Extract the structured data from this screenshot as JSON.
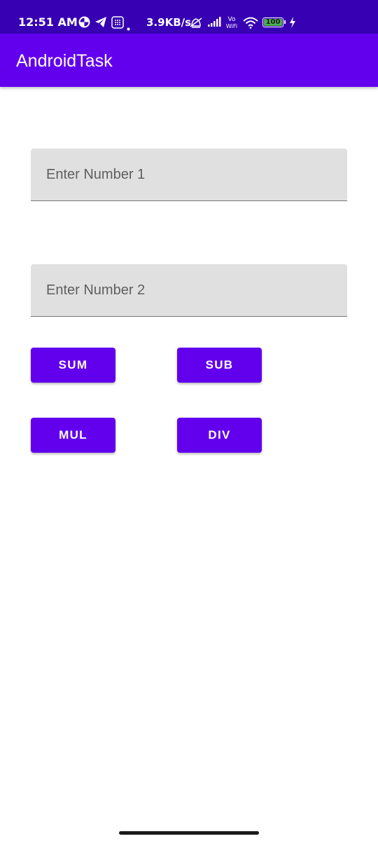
{
  "status_bar": {
    "time": "12:51 AM",
    "network_speed": "3.9KB/s",
    "battery": "100",
    "icons": [
      "data-saver-icon",
      "telegram-icon",
      "notification-icon",
      "dot-icon",
      "alarm-off-icon",
      "signal-icon",
      "vowifi-icon",
      "wifi-icon",
      "battery-icon",
      "charging-icon"
    ],
    "colors": {
      "background": "#3700b3"
    }
  },
  "app_bar": {
    "title": "AndroidTask",
    "color": "#6200ee"
  },
  "inputs": [
    {
      "placeholder": "Enter Number 1",
      "value": ""
    },
    {
      "placeholder": "Enter Number 2",
      "value": ""
    }
  ],
  "buttons": {
    "sum": "SUM",
    "sub": "SUB",
    "mul": "MUL",
    "div": "DIV"
  },
  "colors": {
    "accent": "#6200ee",
    "field_background": "#e0e0e0",
    "placeholder": "#5f5f5f"
  }
}
